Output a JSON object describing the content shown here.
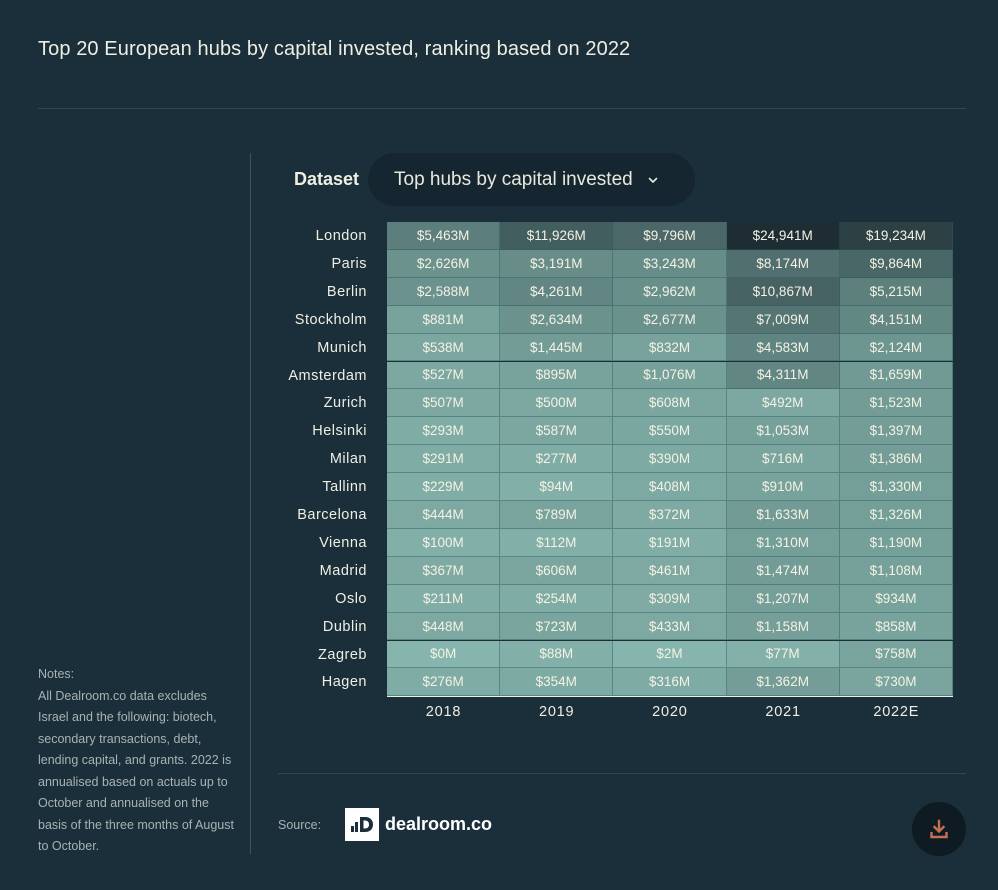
{
  "title": "Top 20 European hubs by capital invested, ranking based on 2022",
  "controls": {
    "dataset_label": "Dataset",
    "dataset_value": "Top hubs by capital invested"
  },
  "notes": {
    "heading": "Notes:",
    "body": "All Dealroom.co data excludes Israel and the following: biotech, secondary transactions, debt, lending capital, and grants. 2022 is annualised based on actuals up to October and annualised on the basis of the three months of August to October."
  },
  "footer": {
    "source_label": "Source:",
    "brand": "dealroom.co",
    "download_icon": "download-icon"
  },
  "colors": {
    "background": "#1b2f3a",
    "cell_low": "#86b5ad",
    "cell_high": "#1e2d33",
    "download_accent": "#c7704f"
  },
  "chart_data": {
    "type": "heatmap",
    "title": "Top 20 European hubs by capital invested, ranking based on 2022",
    "xlabel": "",
    "ylabel": "",
    "unit": "USD millions",
    "columns": [
      "2018",
      "2019",
      "2020",
      "2021",
      "2022E"
    ],
    "rows": [
      "London",
      "Paris",
      "Berlin",
      "Stockholm",
      "Munich",
      "Amsterdam",
      "Zurich",
      "Helsinki",
      "Milan",
      "Tallinn",
      "Barcelona",
      "Vienna",
      "Madrid",
      "Oslo",
      "Dublin",
      "Zagreb",
      "Hagen"
    ],
    "values": [
      [
        5463,
        11926,
        9796,
        24941,
        19234
      ],
      [
        2626,
        3191,
        3243,
        8174,
        9864
      ],
      [
        2588,
        4261,
        2962,
        10867,
        5215
      ],
      [
        881,
        2634,
        2677,
        7009,
        4151
      ],
      [
        538,
        1445,
        832,
        4583,
        2124
      ],
      [
        527,
        895,
        1076,
        4311,
        1659
      ],
      [
        507,
        500,
        608,
        492,
        1523
      ],
      [
        293,
        587,
        550,
        1053,
        1397
      ],
      [
        291,
        277,
        390,
        716,
        1386
      ],
      [
        229,
        94,
        408,
        910,
        1330
      ],
      [
        444,
        789,
        372,
        1633,
        1326
      ],
      [
        100,
        112,
        191,
        1310,
        1190
      ],
      [
        367,
        606,
        461,
        1474,
        1108
      ],
      [
        211,
        254,
        309,
        1207,
        934
      ],
      [
        448,
        723,
        433,
        1158,
        858
      ],
      [
        0,
        88,
        2,
        77,
        758
      ],
      [
        276,
        354,
        316,
        1362,
        730
      ]
    ],
    "labels": [
      [
        "$5,463M",
        "$11,926M",
        "$9,796M",
        "$24,941M",
        "$19,234M"
      ],
      [
        "$2,626M",
        "$3,191M",
        "$3,243M",
        "$8,174M",
        "$9,864M"
      ],
      [
        "$2,588M",
        "$4,261M",
        "$2,962M",
        "$10,867M",
        "$5,215M"
      ],
      [
        "$881M",
        "$2,634M",
        "$2,677M",
        "$7,009M",
        "$4,151M"
      ],
      [
        "$538M",
        "$1,445M",
        "$832M",
        "$4,583M",
        "$2,124M"
      ],
      [
        "$527M",
        "$895M",
        "$1,076M",
        "$4,311M",
        "$1,659M"
      ],
      [
        "$507M",
        "$500M",
        "$608M",
        "$492M",
        "$1,523M"
      ],
      [
        "$293M",
        "$587M",
        "$550M",
        "$1,053M",
        "$1,397M"
      ],
      [
        "$291M",
        "$277M",
        "$390M",
        "$716M",
        "$1,386M"
      ],
      [
        "$229M",
        "$94M",
        "$408M",
        "$910M",
        "$1,330M"
      ],
      [
        "$444M",
        "$789M",
        "$372M",
        "$1,633M",
        "$1,326M"
      ],
      [
        "$100M",
        "$112M",
        "$191M",
        "$1,310M",
        "$1,190M"
      ],
      [
        "$367M",
        "$606M",
        "$461M",
        "$1,474M",
        "$1,108M"
      ],
      [
        "$211M",
        "$254M",
        "$309M",
        "$1,207M",
        "$934M"
      ],
      [
        "$448M",
        "$723M",
        "$433M",
        "$1,158M",
        "$858M"
      ],
      [
        "$0M",
        "$88M",
        "$2M",
        "$77M",
        "$758M"
      ],
      [
        "$276M",
        "$354M",
        "$316M",
        "$1,362M",
        "$730M"
      ]
    ],
    "color_range": [
      0,
      24941
    ],
    "legend": "none",
    "grid": true
  }
}
